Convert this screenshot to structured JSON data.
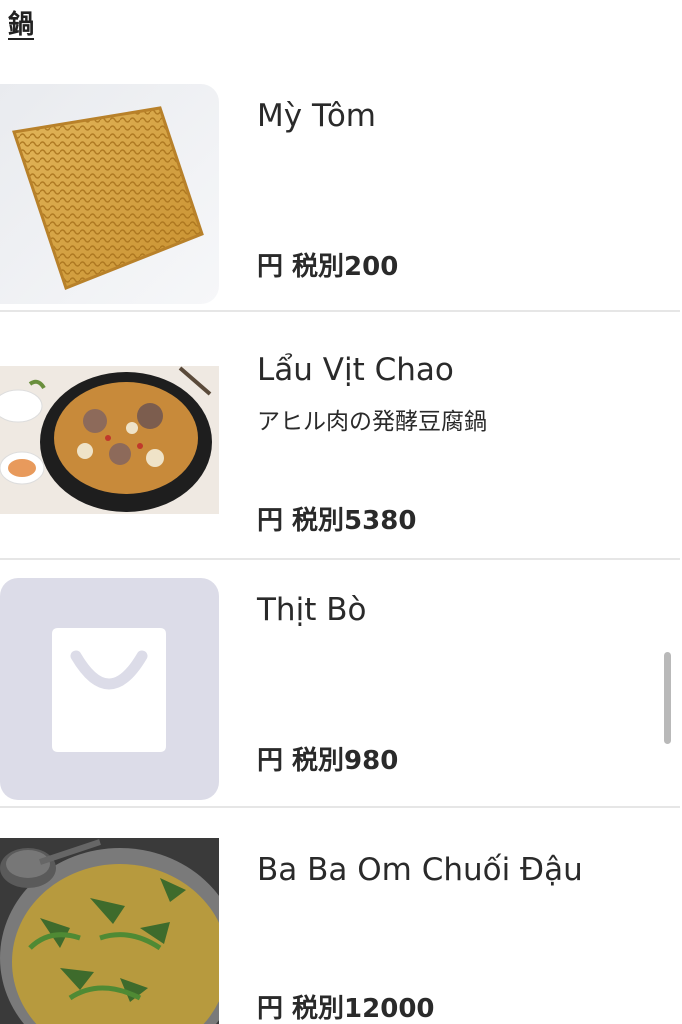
{
  "section": {
    "title": "鍋"
  },
  "items": [
    {
      "name": "Mỳ Tôm",
      "description": "",
      "price": "円 税別200",
      "image": "instant-noodle-block-photo"
    },
    {
      "name": "Lẩu Vịt Chao",
      "description": "アヒル肉の発酵豆腐鍋",
      "price": "円 税別5380",
      "image": "duck-hotpot-photo"
    },
    {
      "name": "Thịt Bò",
      "description": "",
      "price": "円 税別980",
      "image": "shopping-bag-placeholder-icon"
    },
    {
      "name": "Ba Ba Om Chuối Đậu",
      "description": "",
      "price": "円 税別12000",
      "image": "turtle-banana-stew-photo"
    }
  ],
  "colors": {
    "placeholder_bg": "#dcdce8",
    "divider": "#e6e6e6",
    "text": "#2a2a2a"
  }
}
